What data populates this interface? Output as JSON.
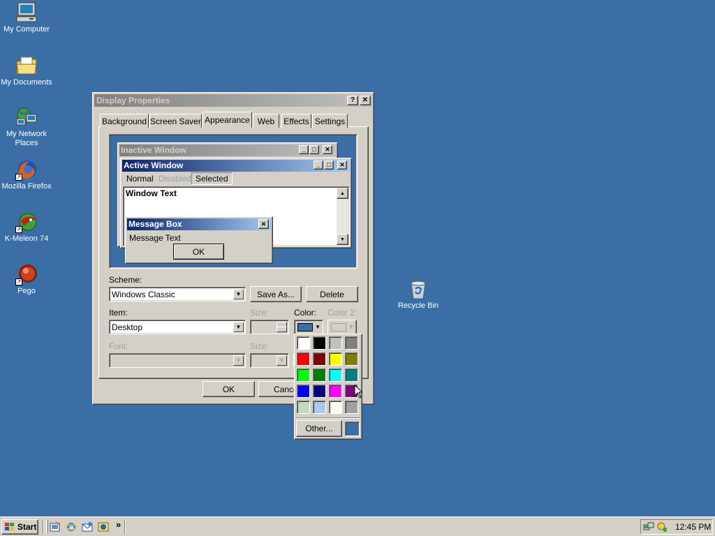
{
  "desktop": {
    "background": "#3a6ea5",
    "icons": [
      {
        "label": "My Computer",
        "icon": "my-computer-icon"
      },
      {
        "label": "My Documents",
        "icon": "my-documents-icon"
      },
      {
        "label": "My Network Places",
        "icon": "network-places-icon"
      },
      {
        "label": "Mozilla Firefox",
        "icon": "firefox-icon"
      },
      {
        "label": "K-Meleon 74",
        "icon": "kmeleon-icon"
      },
      {
        "label": "Pego",
        "icon": "pego-icon"
      },
      {
        "label": "Recycle Bin",
        "icon": "recycle-bin-icon"
      }
    ]
  },
  "dialog": {
    "title": "Display Properties",
    "help_label": "?",
    "close_label": "✕",
    "tabs": [
      {
        "label": "Background"
      },
      {
        "label": "Screen Saver"
      },
      {
        "label": "Appearance",
        "active": true
      },
      {
        "label": "Web"
      },
      {
        "label": "Effects"
      },
      {
        "label": "Settings"
      }
    ],
    "preview": {
      "inactive_title": "Inactive Window",
      "active_title": "Active Window",
      "menu": [
        "Normal",
        "Disabled",
        "Selected"
      ],
      "window_text": "Window Text",
      "message_box_title": "Message Box",
      "message_text": "Message Text",
      "ok_label": "OK"
    },
    "scheme": {
      "label": "Scheme:",
      "value": "Windows Classic",
      "save_as_label": "Save As...",
      "delete_label": "Delete"
    },
    "item": {
      "label": "Item:",
      "value": "Desktop",
      "size_label": "Size:",
      "color_label": "Color:",
      "color2_label": "Color 2:",
      "color_value": "#3a6ea5"
    },
    "font": {
      "label": "Font:",
      "size_label": "Size:"
    },
    "buttons": {
      "ok_label": "OK",
      "cancel_label": "Cancel"
    }
  },
  "color_picker": {
    "swatches": [
      "#ffffff",
      "#000000",
      "#c0c0c0",
      "#808080",
      "#ff0000",
      "#800000",
      "#ffff00",
      "#808000",
      "#00ff00",
      "#008000",
      "#00ffff",
      "#008080",
      "#0000ff",
      "#000080",
      "#ff00ff",
      "#800080",
      "#c0dcc0",
      "#a6caf0",
      "#fffbf0",
      "#a0a0a4"
    ],
    "other_label": "Other...",
    "current_color": "#3a6ea5"
  },
  "taskbar": {
    "start_label": "Start",
    "quick_launch": [
      "show-desktop-icon",
      "ie-icon",
      "outlook-icon",
      "media-icon"
    ],
    "chevron": "»",
    "clock": "12:45 PM"
  }
}
